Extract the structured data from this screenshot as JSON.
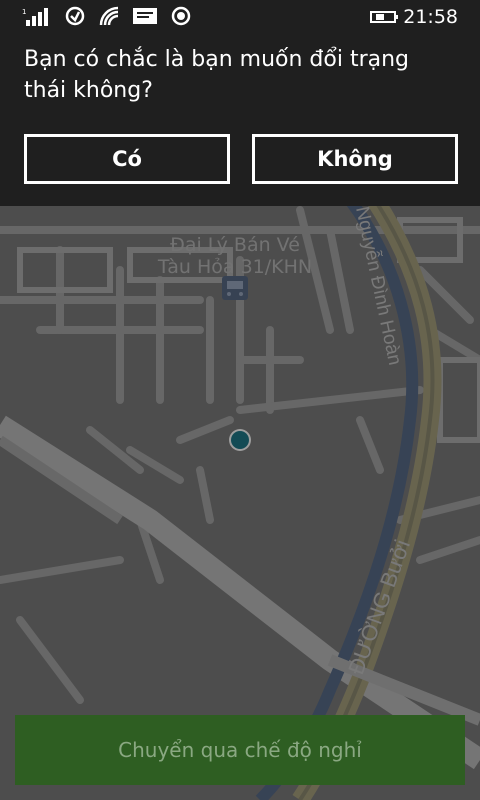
{
  "status_bar": {
    "time": "21:58",
    "icons": [
      "signal-icon",
      "sync-icon",
      "wifi-icon",
      "message-icon",
      "location-icon",
      "battery-charging-icon"
    ]
  },
  "dialog": {
    "question": "Bạn có chắc là bạn muốn đổi trạng thái không?",
    "yes_label": "Có",
    "no_label": "Không"
  },
  "map": {
    "poi_line1": "Đại Lý Bán Vé",
    "poi_line2": "Tàu Hỏa 31/KHN",
    "street1": "Nguyễn Đình Hoàn",
    "street2": "ĐƯỜNG Bưởi"
  },
  "bottom_action": {
    "label": "Chuyển qua chế độ nghỉ"
  }
}
